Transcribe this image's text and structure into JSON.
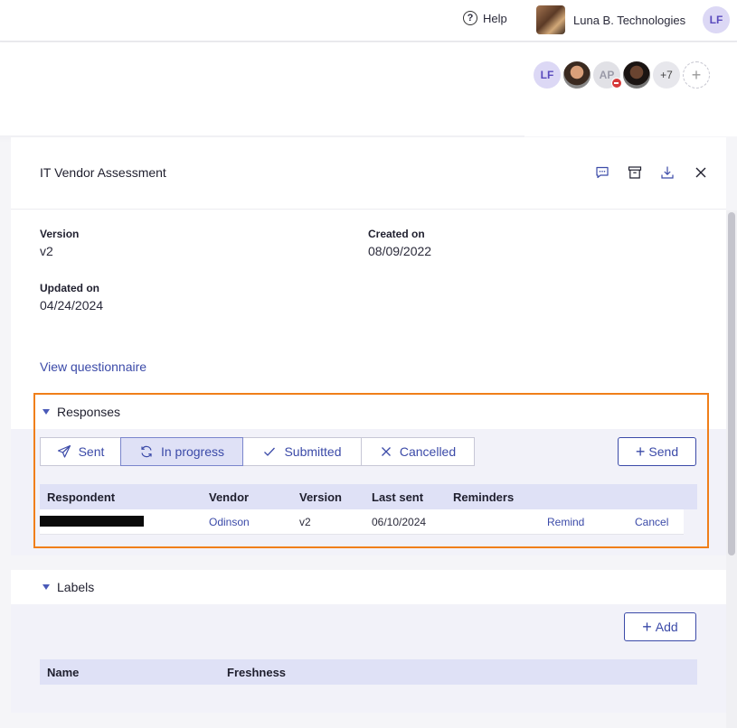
{
  "topbar": {
    "help_label": "Help",
    "help_icon": "question-circle-icon",
    "org_name": "Luna B. Technologies",
    "user_initials": "LF"
  },
  "collaborators": {
    "avatars": [
      {
        "type": "initials",
        "text": "LF"
      },
      {
        "type": "photo"
      },
      {
        "type": "initials",
        "text": "AP",
        "status": "removed"
      },
      {
        "type": "photo"
      }
    ],
    "more_count": "+7",
    "add_label": "+"
  },
  "panel": {
    "title": "IT Vendor Assessment",
    "icons": [
      "comment-icon",
      "archive-icon",
      "download-icon",
      "close-icon"
    ],
    "version_label": "Version",
    "version_value": "v2",
    "created_label": "Created on",
    "created_value": "08/09/2022",
    "updated_label": "Updated on",
    "updated_value": "04/24/2024",
    "view_link": "View questionnaire"
  },
  "responses": {
    "title": "Responses",
    "filters": [
      {
        "label": "Sent",
        "icon": "send-icon",
        "active": false
      },
      {
        "label": "In progress",
        "icon": "refresh-icon",
        "active": true
      },
      {
        "label": "Submitted",
        "icon": "check-icon",
        "active": false
      },
      {
        "label": "Cancelled",
        "icon": "x-icon",
        "active": false
      }
    ],
    "send_label": "Send",
    "columns": [
      "Respondent",
      "Vendor",
      "Version",
      "Last sent",
      "Reminders"
    ],
    "rows": [
      {
        "respondent": "",
        "vendor": "Odinson",
        "version": "v2",
        "last_sent": "06/10/2024",
        "reminders": "",
        "remind_label": "Remind",
        "cancel_label": "Cancel"
      }
    ]
  },
  "labels": {
    "title": "Labels",
    "add_label": "Add",
    "columns": [
      "Name",
      "Freshness"
    ]
  },
  "colors": {
    "accent": "#3b4aa8",
    "highlight": "#f07f1a",
    "table_header": "#dfe1f6"
  }
}
